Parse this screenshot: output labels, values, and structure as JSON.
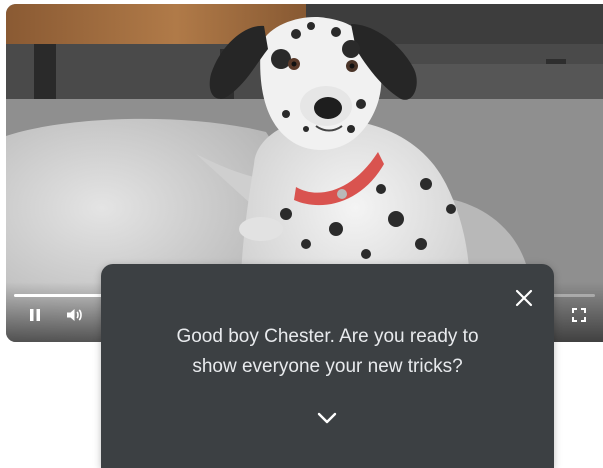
{
  "player": {
    "progress_fraction": 0.16,
    "controls": {
      "pause_icon": "pause-icon",
      "volume_icon": "volume-icon",
      "fullscreen_icon": "fullscreen-icon"
    }
  },
  "card": {
    "message_line1": "Good boy Chester. Are you ready to",
    "message_line2": "show everyone your new tricks?",
    "close_icon": "close-icon",
    "expand_icon": "chevron-down-icon"
  },
  "colors": {
    "card_background": "#3c4043",
    "card_text": "#e8eaed",
    "collar": "#d9534f",
    "floor_wood": "#a06a3e"
  }
}
